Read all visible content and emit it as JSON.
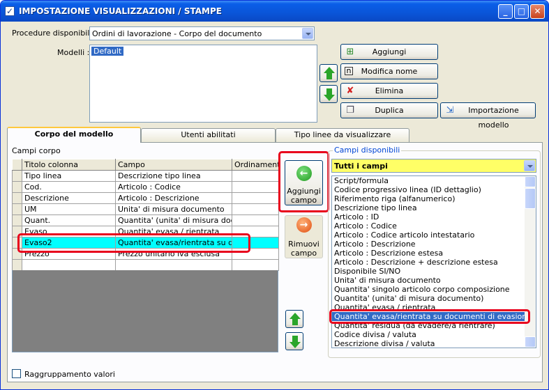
{
  "window": {
    "title": "IMPOSTAZIONE VISUALIZZAZIONI / STAMPE",
    "minimize": "_",
    "maximize": "□",
    "close": "✕"
  },
  "procedure": {
    "label": "Procedure disponibili :",
    "selected": "Ordini di lavorazione - Corpo del documento"
  },
  "models": {
    "label": "Modelli :",
    "items": [
      "Default"
    ]
  },
  "buttons": {
    "add": "Aggiungi",
    "rename": "Modifica nome",
    "delete": "Elimina",
    "duplicate": "Duplica",
    "import": "Importazione modello",
    "add_field": "Aggiungi campo",
    "remove_field": "Rimuovi campo"
  },
  "tabs": [
    "Corpo del modello",
    "Utenti abilitati",
    "Tipo linee da visualizzare"
  ],
  "body_fields": {
    "label": "Campi corpo",
    "columns": [
      "Titolo colonna",
      "Campo",
      "Ordinamento"
    ],
    "rows": [
      {
        "title": "Tipo linea",
        "field": "Descrizione tipo linea",
        "order": ""
      },
      {
        "title": "Cod.",
        "field": "Articolo : Codice",
        "order": ""
      },
      {
        "title": "Descrizione",
        "field": "Articolo : Descrizione",
        "order": ""
      },
      {
        "title": "UM",
        "field": "Unita' di misura documento",
        "order": ""
      },
      {
        "title": "Quant.",
        "field": "Quantita' (unita' di misura docum...",
        "order": ""
      },
      {
        "title": "Evaso",
        "field": "Quantita' evasa / rientrata",
        "order": ""
      },
      {
        "title": "Evaso2",
        "field": "Quantita' evasa/rientrata su doc...",
        "order": ""
      },
      {
        "title": "Prezzo",
        "field": "Prezzo unitario iva esclusa",
        "order": ""
      },
      {
        "title": "",
        "field": "",
        "order": ""
      }
    ]
  },
  "available_fields": {
    "label": "Campi disponibili",
    "filter": "Tutti i campi",
    "items": [
      "Script/formula",
      "Codice progressivo linea (ID dettaglio)",
      "Riferimento riga (alfanumerico)",
      "Descrizione tipo linea",
      "Articolo : ID",
      "Articolo : Codice",
      "Articolo : Codice articolo intestatario",
      "Articolo : Descrizione",
      "Articolo : Descrizione estesa",
      "Articolo : Descrizione + descrizione estesa",
      "Disponibile SI/NO",
      "Unita' di misura documento",
      "Quantita' singolo articolo corpo composizione",
      "Quantita' (unita' di misura documento)",
      "Quantita' evasa / rientrata",
      "Quantita' evasa/rientrata su documenti di evasione collegati",
      "Quantita' residua (da evadere/a rientrare)",
      "Codice divisa / valuta",
      "Descrizione divisa / valuta"
    ]
  },
  "grouping": {
    "label": "Raggruppamento valori"
  }
}
